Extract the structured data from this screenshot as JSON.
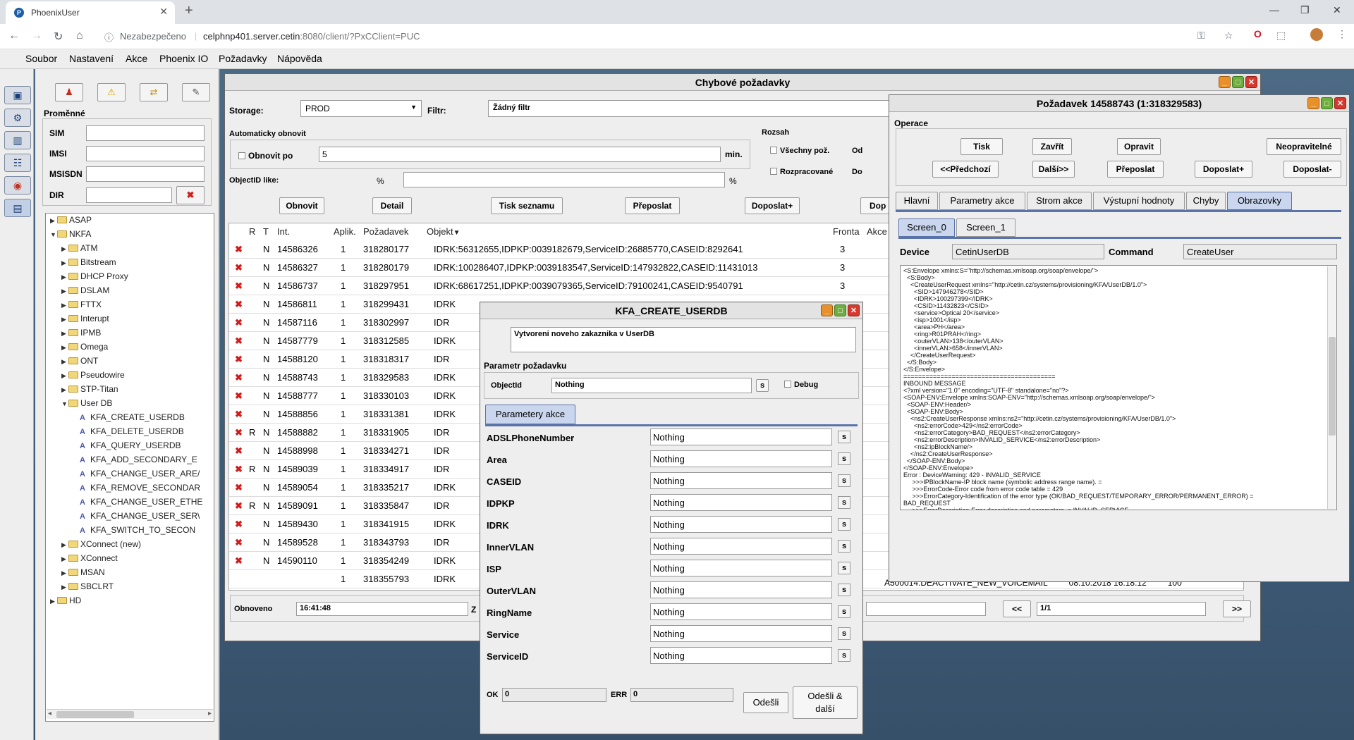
{
  "browser": {
    "tab_title": "PhoenixUser",
    "security": "Nezabezpečeno",
    "url_host": "celphnp401.server.cetin",
    "url_rest": ":8080/client/?PxCClient=PUC"
  },
  "menu": [
    "Soubor",
    "Nastavení",
    "Akce",
    "Phoenix IO",
    "Požadavky",
    "Nápověda"
  ],
  "left_panel": {
    "section_title": "Proměnné",
    "fields": [
      {
        "label": "SIM",
        "value": ""
      },
      {
        "label": "IMSI",
        "value": ""
      },
      {
        "label": "MSISDN",
        "value": ""
      },
      {
        "label": "DIR",
        "value": ""
      }
    ],
    "tree": [
      {
        "label": "ASAP",
        "depth": 1,
        "kind": "folder",
        "expanded": false
      },
      {
        "label": "NKFA",
        "depth": 1,
        "kind": "folder",
        "expanded": true
      },
      {
        "label": "ATM",
        "depth": 2,
        "kind": "folder",
        "expanded": false
      },
      {
        "label": "Bitstream",
        "depth": 2,
        "kind": "folder",
        "expanded": false
      },
      {
        "label": "DHCP Proxy",
        "depth": 2,
        "kind": "folder",
        "expanded": false
      },
      {
        "label": "DSLAM",
        "depth": 2,
        "kind": "folder",
        "expanded": false
      },
      {
        "label": "FTTX",
        "depth": 2,
        "kind": "folder",
        "expanded": false
      },
      {
        "label": "Interupt",
        "depth": 2,
        "kind": "folder",
        "expanded": false
      },
      {
        "label": "IPMB",
        "depth": 2,
        "kind": "folder",
        "expanded": false
      },
      {
        "label": "Omega",
        "depth": 2,
        "kind": "folder",
        "expanded": false
      },
      {
        "label": "ONT",
        "depth": 2,
        "kind": "folder",
        "expanded": false
      },
      {
        "label": "Pseudowire",
        "depth": 2,
        "kind": "folder",
        "expanded": false
      },
      {
        "label": "STP-Titan",
        "depth": 2,
        "kind": "folder",
        "expanded": false
      },
      {
        "label": "User DB",
        "depth": 2,
        "kind": "folder",
        "expanded": true
      },
      {
        "label": "KFA_CREATE_USERDB",
        "depth": 3,
        "kind": "leaf"
      },
      {
        "label": "KFA_DELETE_USERDB",
        "depth": 3,
        "kind": "leaf"
      },
      {
        "label": "KFA_QUERY_USERDB",
        "depth": 3,
        "kind": "leaf"
      },
      {
        "label": "KFA_ADD_SECONDARY_E",
        "depth": 3,
        "kind": "leaf"
      },
      {
        "label": "KFA_CHANGE_USER_ARE/",
        "depth": 3,
        "kind": "leaf"
      },
      {
        "label": "KFA_REMOVE_SECONDAR",
        "depth": 3,
        "kind": "leaf"
      },
      {
        "label": "KFA_CHANGE_USER_ETHE",
        "depth": 3,
        "kind": "leaf"
      },
      {
        "label": "KFA_CHANGE_USER_SER\\",
        "depth": 3,
        "kind": "leaf"
      },
      {
        "label": "KFA_SWITCH_TO_SECON",
        "depth": 3,
        "kind": "leaf"
      },
      {
        "label": "XConnect (new)",
        "depth": 2,
        "kind": "folder",
        "expanded": false
      },
      {
        "label": "XConnect",
        "depth": 2,
        "kind": "folder",
        "expanded": false
      },
      {
        "label": "MSAN",
        "depth": 2,
        "kind": "folder",
        "expanded": false
      },
      {
        "label": "SBCLRT",
        "depth": 2,
        "kind": "folder",
        "expanded": false
      },
      {
        "label": "HD",
        "depth": 1,
        "kind": "folder",
        "expanded": false
      }
    ]
  },
  "chybove": {
    "title": "Chybové požadavky",
    "storage_label": "Storage:",
    "storage_value": "PROD",
    "filtr_label": "Filtr:",
    "filtr_value": "Žádný filtr",
    "auto_label": "Automaticky obnovit",
    "obnovit_po": "Obnovit po",
    "obnovit_value": "5",
    "min": "min.",
    "rozsah": "Rozsah",
    "vsechny": "Všechny pož.",
    "rozpracovane": "Rozpracované",
    "od": "Od",
    "do": "Do",
    "objectid_like": "ObjectID like:",
    "pct1": "%",
    "pct2": "%",
    "buttons": {
      "obnovit": "Obnovit",
      "detail": "Detail",
      "tisk": "Tisk seznamu",
      "preposlat": "Přeposlat",
      "doposlat": "Doposlat+",
      "dop": "Dop"
    },
    "columns": [
      "R",
      "T",
      "Int.",
      "Aplik.",
      "Požadavek",
      "Objekt",
      "Fronta",
      "Akce"
    ],
    "rows": [
      {
        "r": "",
        "t": "N",
        "int": "14586326",
        "aplik": "1",
        "pozadavek": "318280177",
        "objekt": "IDRK:56312655,IDPKP:0039182679,ServiceID:26885770,CASEID:8292641",
        "fronta": "3"
      },
      {
        "r": "",
        "t": "N",
        "int": "14586327",
        "aplik": "1",
        "pozadavek": "318280179",
        "objekt": "IDRK:100286407,IDPKP:0039183547,ServiceID:147932822,CASEID:11431013",
        "fronta": "3"
      },
      {
        "r": "",
        "t": "N",
        "int": "14586737",
        "aplik": "1",
        "pozadavek": "318297951",
        "objekt": "IDRK:68617251,IDPKP:0039079365,ServiceID:79100241,CASEID:9540791",
        "fronta": "3"
      },
      {
        "r": "",
        "t": "N",
        "int": "14586811",
        "aplik": "1",
        "pozadavek": "318299431",
        "objekt": "IDRK",
        "fronta": ""
      },
      {
        "r": "",
        "t": "N",
        "int": "14587116",
        "aplik": "1",
        "pozadavek": "318302997",
        "objekt": "IDR",
        "fronta": ""
      },
      {
        "r": "",
        "t": "N",
        "int": "14587779",
        "aplik": "1",
        "pozadavek": "318312585",
        "objekt": "IDRK",
        "fronta": ""
      },
      {
        "r": "",
        "t": "N",
        "int": "14588120",
        "aplik": "1",
        "pozadavek": "318318317",
        "objekt": "IDR",
        "fronta": ""
      },
      {
        "r": "",
        "t": "N",
        "int": "14588743",
        "aplik": "1",
        "pozadavek": "318329583",
        "objekt": "IDRK",
        "fronta": ""
      },
      {
        "r": "",
        "t": "N",
        "int": "14588777",
        "aplik": "1",
        "pozadavek": "318330103",
        "objekt": "IDRK",
        "fronta": ""
      },
      {
        "r": "",
        "t": "N",
        "int": "14588856",
        "aplik": "1",
        "pozadavek": "318331381",
        "objekt": "IDRK",
        "fronta": ""
      },
      {
        "r": "R",
        "t": "N",
        "int": "14588882",
        "aplik": "1",
        "pozadavek": "318331905",
        "objekt": "IDR",
        "fronta": ""
      },
      {
        "r": "",
        "t": "N",
        "int": "14588998",
        "aplik": "1",
        "pozadavek": "318334271",
        "objekt": "IDR",
        "fronta": ""
      },
      {
        "r": "R",
        "t": "N",
        "int": "14589039",
        "aplik": "1",
        "pozadavek": "318334917",
        "objekt": "IDR",
        "fronta": ""
      },
      {
        "r": "",
        "t": "N",
        "int": "14589054",
        "aplik": "1",
        "pozadavek": "318335217",
        "objekt": "IDRK",
        "fronta": ""
      },
      {
        "r": "R",
        "t": "N",
        "int": "14589091",
        "aplik": "1",
        "pozadavek": "318335847",
        "objekt": "IDR",
        "fronta": ""
      },
      {
        "r": "",
        "t": "N",
        "int": "14589430",
        "aplik": "1",
        "pozadavek": "318341915",
        "objekt": "IDRK",
        "fronta": ""
      },
      {
        "r": "",
        "t": "N",
        "int": "14589528",
        "aplik": "1",
        "pozadavek": "318343793",
        "objekt": "IDR",
        "fronta": ""
      },
      {
        "r": "",
        "t": "N",
        "int": "14590110",
        "aplik": "1",
        "pozadavek": "318354249",
        "objekt": "IDRK",
        "fronta": ""
      },
      {
        "r": "",
        "t": "",
        "int": "",
        "aplik": "1",
        "pozadavek": "318355793",
        "objekt": "IDRK",
        "fronta": ""
      }
    ],
    "behind_row": {
      "action": "A500014:DEACTIVATE_NEW_VOICEMAIL",
      "date": "08.10.2018 16:18:12",
      "num": "100"
    },
    "obnoveno_label": "Obnoveno",
    "obnoveno_value": "16:41:48",
    "z": "Z",
    "page": "1/1",
    "prev": "<<",
    "next": ">>"
  },
  "kfa": {
    "title": "KFA_CREATE_USERDB",
    "description": "Vytvoreni noveho zakaznika v UserDB",
    "parametr_label": "Parametr požadavku",
    "objectid_label": "ObjectId",
    "objectid_value": "Nothing",
    "s": "s",
    "debug": "Debug",
    "tab": "Parametery akce",
    "params": [
      {
        "name": "ADSLPhoneNumber",
        "value": "Nothing"
      },
      {
        "name": "Area",
        "value": "Nothing"
      },
      {
        "name": "CASEID",
        "value": "Nothing"
      },
      {
        "name": "IDPKP",
        "value": "Nothing"
      },
      {
        "name": "IDRK",
        "value": "Nothing"
      },
      {
        "name": "InnerVLAN",
        "value": "Nothing"
      },
      {
        "name": "ISP",
        "value": "Nothing"
      },
      {
        "name": "OuterVLAN",
        "value": "Nothing"
      },
      {
        "name": "RingName",
        "value": "Nothing"
      },
      {
        "name": "Service",
        "value": "Nothing"
      },
      {
        "name": "ServiceID",
        "value": "Nothing"
      }
    ],
    "ok_label": "OK",
    "ok_value": "0",
    "err_label": "ERR",
    "err_value": "0",
    "odesli": "Odešli",
    "odesli_dalsi_1": "Odešli &",
    "odesli_dalsi_2": "další"
  },
  "pozadavek": {
    "title": "Požadavek 14588743 (1:318329583)",
    "operace": "Operace",
    "buttons_row1": [
      "Tisk",
      "Zavřít",
      "Opravit",
      "Neopravitelné"
    ],
    "buttons_row2": [
      "<<Předchozí",
      "Další>>",
      "Přeposlat",
      "Doposlat+",
      "Doposlat-"
    ],
    "tabs": [
      "Hlavní",
      "Parametry akce",
      "Strom akce",
      "Výstupní hodnoty",
      "Chyby",
      "Obrazovky"
    ],
    "active_tab": "Obrazovky",
    "screens": [
      "Screen_0",
      "Screen_1"
    ],
    "device_label": "Device",
    "device_value": "CetinUserDB",
    "command_label": "Command",
    "command_value": "CreateUser",
    "xml_lines": [
      "<S:Envelope xmlns:S=\"http://schemas.xmlsoap.org/soap/envelope/\">",
      "  <S:Body>",
      "    <CreateUserRequest xmlns=\"http://cetin.cz/systems/provisioning/KFA/UserDB/1.0\">",
      "      <SID>147946278</SID>",
      "      <IDRK>100297399</IDRK>",
      "      <CSID>11432823</CSID>",
      "      <service>Optical 20</service>",
      "      <isp>1001</isp>",
      "      <area>PH</area>",
      "      <ring>R01PRAH</ring>",
      "      <outerVLAN>138</outerVLAN>",
      "      <innerVLAN>658</innerVLAN>",
      "    </CreateUserRequest>",
      "  </S:Body>",
      "</S:Envelope>",
      "=========================================",
      "INBOUND MESSAGE",
      "<?xml version=\"1.0\" encoding=\"UTF-8\" standalone=\"no\"?>",
      "<SOAP-ENV:Envelope xmlns:SOAP-ENV=\"http://schemas.xmlsoap.org/soap/envelope/\">",
      "  <SOAP-ENV:Header/>",
      "  <SOAP-ENV:Body>",
      "    <ns2:CreateUserResponse xmlns:ns2=\"http://cetin.cz/systems/provisioning/KFA/UserDB/1.0\">",
      "      <ns2:errorCode>429</ns2:errorCode>",
      "      <ns2:errorCategory>BAD_REQUEST</ns2:errorCategory>",
      "      <ns2:errorDescription>INVALID_SERVICE</ns2:errorDescription>",
      "      <ns2:ipBlockName/>",
      "    </ns2:CreateUserResponse>",
      "  </SOAP-ENV:Body>",
      "</SOAP-ENV:Envelope>",
      "Error : DeviceWarning: 429 - INVALID_SERVICE",
      "     >>>IPBlockName-IP block name (symbolic address range name). =",
      "     >>>ErrorCode-Error code from error code table = 429",
      "     >>>ErrorCategory-Identification of the error type (OK/BAD_REQUEST/TEMPORARY_ERROR/PERMANENT_ERROR) =",
      "BAD_REQUEST",
      "     >>>ErrorDescription-Error description and parameters. = INVALID_SERVICE"
    ]
  }
}
